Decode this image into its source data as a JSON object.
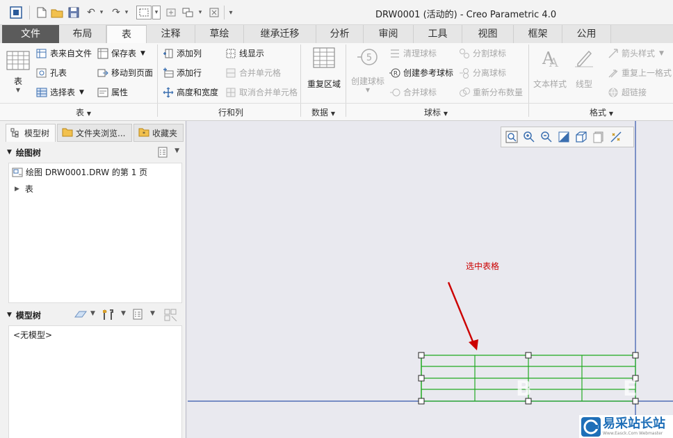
{
  "window": {
    "title": "DRW0001 (活动的) - Creo Parametric 4.0"
  },
  "tabs": [
    "文件",
    "布局",
    "表",
    "注释",
    "草绘",
    "继承迁移",
    "分析",
    "审阅",
    "工具",
    "视图",
    "框架",
    "公用"
  ],
  "ribbon": {
    "table_group": {
      "big_button": "表",
      "from_file": "表来自文件",
      "save_table": "保存表",
      "hole_table": "孔表",
      "move_to_page": "移动到页面",
      "select_table": "选择表",
      "properties": "属性",
      "label": "表"
    },
    "rows_cols_group": {
      "add_column": "添加列",
      "line_display": "线显示",
      "add_row": "添加行",
      "merge_cells": "合并单元格",
      "height_width": "高度和宽度",
      "unmerge_cells": "取消合并单元格",
      "label": "行和列"
    },
    "data_group": {
      "repeat_region": "重复区域",
      "label": "数据"
    },
    "balloon_group": {
      "create_balloon": "创建球标",
      "clean_balloon": "清理球标",
      "create_ref_balloon": "创建参考球标",
      "merge_balloon": "合并球标",
      "split_balloon": "分割球标",
      "detach_balloon": "分离球标",
      "redistribute_qty": "重新分布数量",
      "label": "球标"
    },
    "format_group": {
      "text_style": "文本样式",
      "line_style": "线型",
      "arrow_style": "箭头样式",
      "repeat_last_format": "重复上一格式",
      "hyperlink": "超链接",
      "label": "格式"
    }
  },
  "left_panel": {
    "tabs": [
      "模型树",
      "文件夹浏览...",
      "收藏夹"
    ],
    "drawing_tree": {
      "title": "绘图树",
      "items": [
        "绘图 DRW0001.DRW 的第 1 页",
        "表"
      ]
    },
    "model_tree": {
      "title": "模型树",
      "items": [
        "<无模型>"
      ]
    }
  },
  "canvas": {
    "annotation": "选中表格",
    "ghost_letters": [
      "B",
      "E"
    ]
  },
  "watermark": {
    "text": "易采站长站",
    "small": "Www.Easck.Com Webmaster"
  },
  "colors": {
    "annotation": "#cc0000",
    "table_lines": "#22aa22",
    "border_blue": "#3355aa",
    "file_tab": "#5b5b5b"
  }
}
